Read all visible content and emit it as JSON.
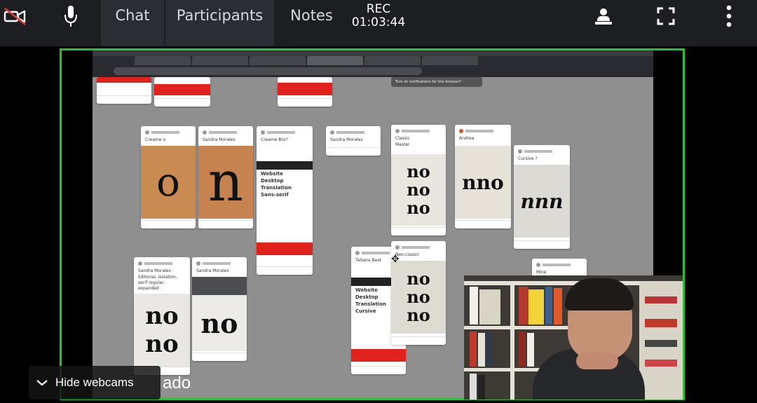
{
  "toolbar": {
    "camera_icon": "video-off-icon",
    "mic_icon": "microphone-icon",
    "tabs": [
      {
        "label": "Chat"
      },
      {
        "label": "Participants"
      },
      {
        "label": "Notes"
      }
    ],
    "rec_label": "REC",
    "rec_time": "01:03:44",
    "presenter_icon": "presenter-icon",
    "fullscreen_icon": "fullscreen-icon",
    "more_icon": "more-vertical-icon"
  },
  "share": {
    "accent": "#27c331",
    "notification": "Turn on notifications for this browser?",
    "cards": [
      {
        "title": "Creame o",
        "photo": "o"
      },
      {
        "title": "Sandra Morales",
        "photo": "n"
      },
      {
        "title": "Creame Bro?",
        "sub": [
          "Website",
          "Desktop",
          "Translation",
          "Sans-serif"
        ]
      },
      {
        "title": "Sandra Morales"
      },
      {
        "title": "Classic",
        "sub": [
          "Master"
        ],
        "photo": "no no no"
      },
      {
        "title": "Andrea",
        "photo": "nno"
      },
      {
        "title": "Cursive ?",
        "photo": "nnn"
      },
      {
        "title": "Sandra Morales",
        "sub": [
          "Editorial, isolation, serif regular, expanded"
        ],
        "photo": "no no"
      },
      {
        "title": "Sandra Morales",
        "photo": "no"
      },
      {
        "title": "Tatiana Beet",
        "sub": [
          "Website",
          "Desktop",
          "Translation",
          "Cursive"
        ]
      },
      {
        "title": "Neo-classic",
        "photo": "no no no"
      },
      {
        "title": "Mine"
      }
    ]
  },
  "webcams": {
    "hide_label": "Hide webcams",
    "chevron_icon": "chevron-down-icon",
    "participant_name_partial": "ado"
  }
}
